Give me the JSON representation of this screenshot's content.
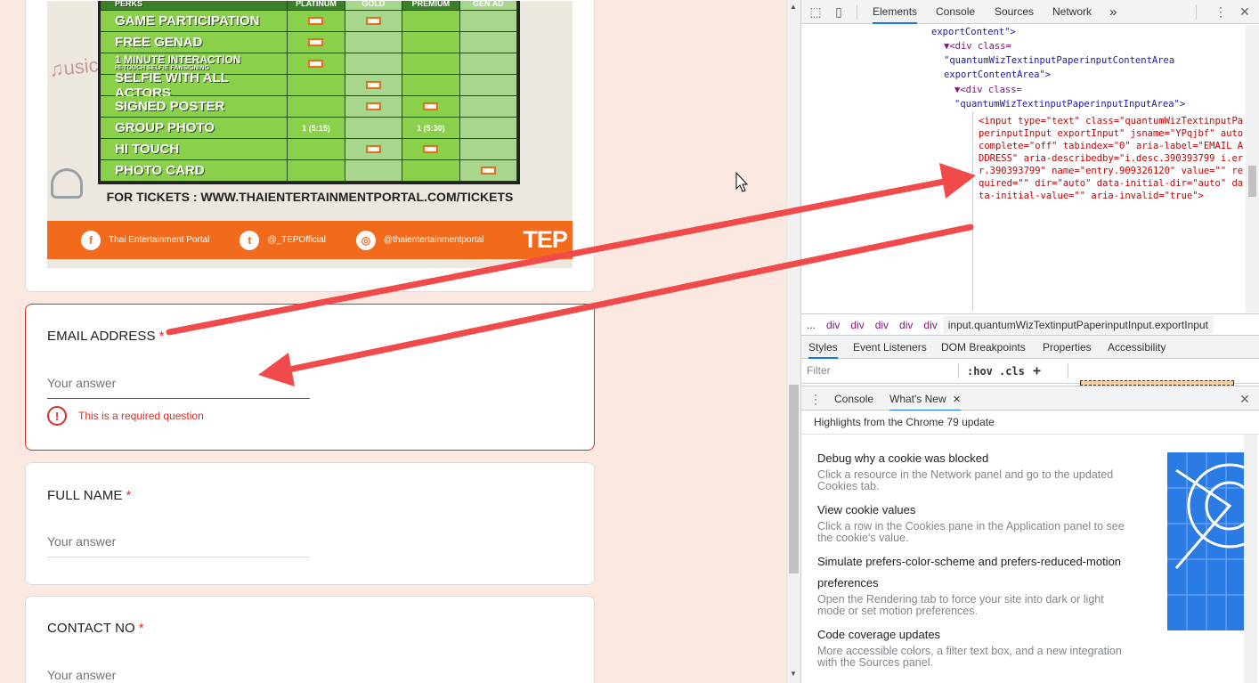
{
  "poster": {
    "table_header": {
      "perks": "PERKS",
      "tiers": [
        "PLATINUM",
        "GOLD",
        "PREMIUM",
        "GEN AD"
      ]
    },
    "rows": [
      {
        "perk": "GAME PARTICIPATION",
        "sub": "",
        "cells": [
          "x",
          "x",
          "",
          ""
        ]
      },
      {
        "perk": "FREE GENAD",
        "sub": "",
        "cells": [
          "x",
          "",
          "",
          ""
        ]
      },
      {
        "perk": "1 MINUTE INTERACTION",
        "sub": "HI-TOUCH   SELFIE   FANSIGNING",
        "cells": [
          "x",
          "",
          "",
          ""
        ]
      },
      {
        "perk": "SELFIE WITH ALL ACTORS",
        "sub": "",
        "cells": [
          "",
          "x",
          "",
          ""
        ]
      },
      {
        "perk": "SIGNED POSTER",
        "sub": "",
        "cells": [
          "",
          "x",
          "x",
          ""
        ]
      },
      {
        "perk": "GROUP PHOTO",
        "sub": "",
        "cells": [
          "1 (5:15)",
          "",
          "1 (5:30)",
          ""
        ]
      },
      {
        "perk": "HI TOUCH",
        "sub": "",
        "cells": [
          "",
          "x",
          "x",
          ""
        ]
      },
      {
        "perk": "PHOTO CARD",
        "sub": "",
        "cells": [
          "",
          "",
          "",
          "x"
        ]
      }
    ],
    "tickets_line": "FOR TICKETS : WWW.THAIENTERTAINMENTPORTAL.COM/TICKETS",
    "footer": {
      "facebook": "Thai Entertainment Portal",
      "twitter": "@_TEPOfficial",
      "instagram": "@thaientertainmentportal",
      "logo": "TEP"
    },
    "deco_music": "♫usic"
  },
  "form": {
    "email": {
      "title": "EMAIL ADDRESS",
      "required_mark": "*",
      "placeholder": "Your answer",
      "error": "This is a required question"
    },
    "name": {
      "title": "FULL NAME",
      "required_mark": "*",
      "placeholder": "Your answer"
    },
    "contact": {
      "title": "CONTACT NO",
      "required_mark": "*",
      "placeholder": "Your answer"
    }
  },
  "devtools": {
    "tabs": [
      "Elements",
      "Console",
      "Sources",
      "Network"
    ],
    "more": "»",
    "tree": [
      {
        "text": "exportContent\">"
      },
      {
        "text": "▼<div class="
      },
      {
        "text": "\"quantumWizTextinputPaperinputContentArea"
      },
      {
        "text": "exportContentArea\">"
      },
      {
        "text": "▼<div class="
      },
      {
        "text": "\"quantumWizTextinputPaperinputInputArea\">"
      }
    ],
    "selected_node": "<input type=\"text\" class=\"quantumWizTextinputPaperinputInput exportInput\" jsname=\"YPqjbf\" autocomplete=\"off\" tabindex=\"0\" aria-label=\"EMAIL ADDRESS\" aria-describedby=\"i.desc.390393799 i.err.390393799\" name=\"entry.909326120\" value=\"\" required=\"\" dir=\"auto\" data-initial-dir=\"auto\" data-initial-value=\"\" aria-invalid=\"true\">",
    "breadcrumbs": [
      "...",
      "div",
      "div",
      "div",
      "div",
      "div"
    ],
    "breadcrumb_selected": "input.quantumWizTextinputPaperinputInput.exportInput",
    "styles_tabs": [
      "Styles",
      "Event Listeners",
      "DOM Breakpoints",
      "Properties",
      "Accessibility"
    ],
    "filter_placeholder": "Filter",
    "filter_buttons": [
      ":hov",
      ".cls",
      "+"
    ],
    "drawer_tabs": [
      "Console",
      "What's New"
    ],
    "whats_new_header": "Highlights from the Chrome 79 update",
    "whats_new": [
      {
        "title": "Debug why a cookie was blocked",
        "desc": "Click a resource in the Network panel and go to the updated Cookies tab."
      },
      {
        "title": "View cookie values",
        "desc": "Click a row in the Cookies pane in the Application panel to see the cookie's value."
      },
      {
        "title": "Simulate prefers-color-scheme and prefers-reduced-motion preferences",
        "desc": "Open the Rendering tab to force your site into dark or light mode or set motion preferences."
      },
      {
        "title": "Code coverage updates",
        "desc": "More accessible colors, a filter text box, and a new integration with the Sources panel."
      }
    ]
  },
  "colors": {
    "error": "#d93025",
    "arrow": "#f04a4a",
    "poster_green": "#8bd04a",
    "poster_orange": "#f26a1b",
    "devtools_accent": "#1a73e8"
  }
}
